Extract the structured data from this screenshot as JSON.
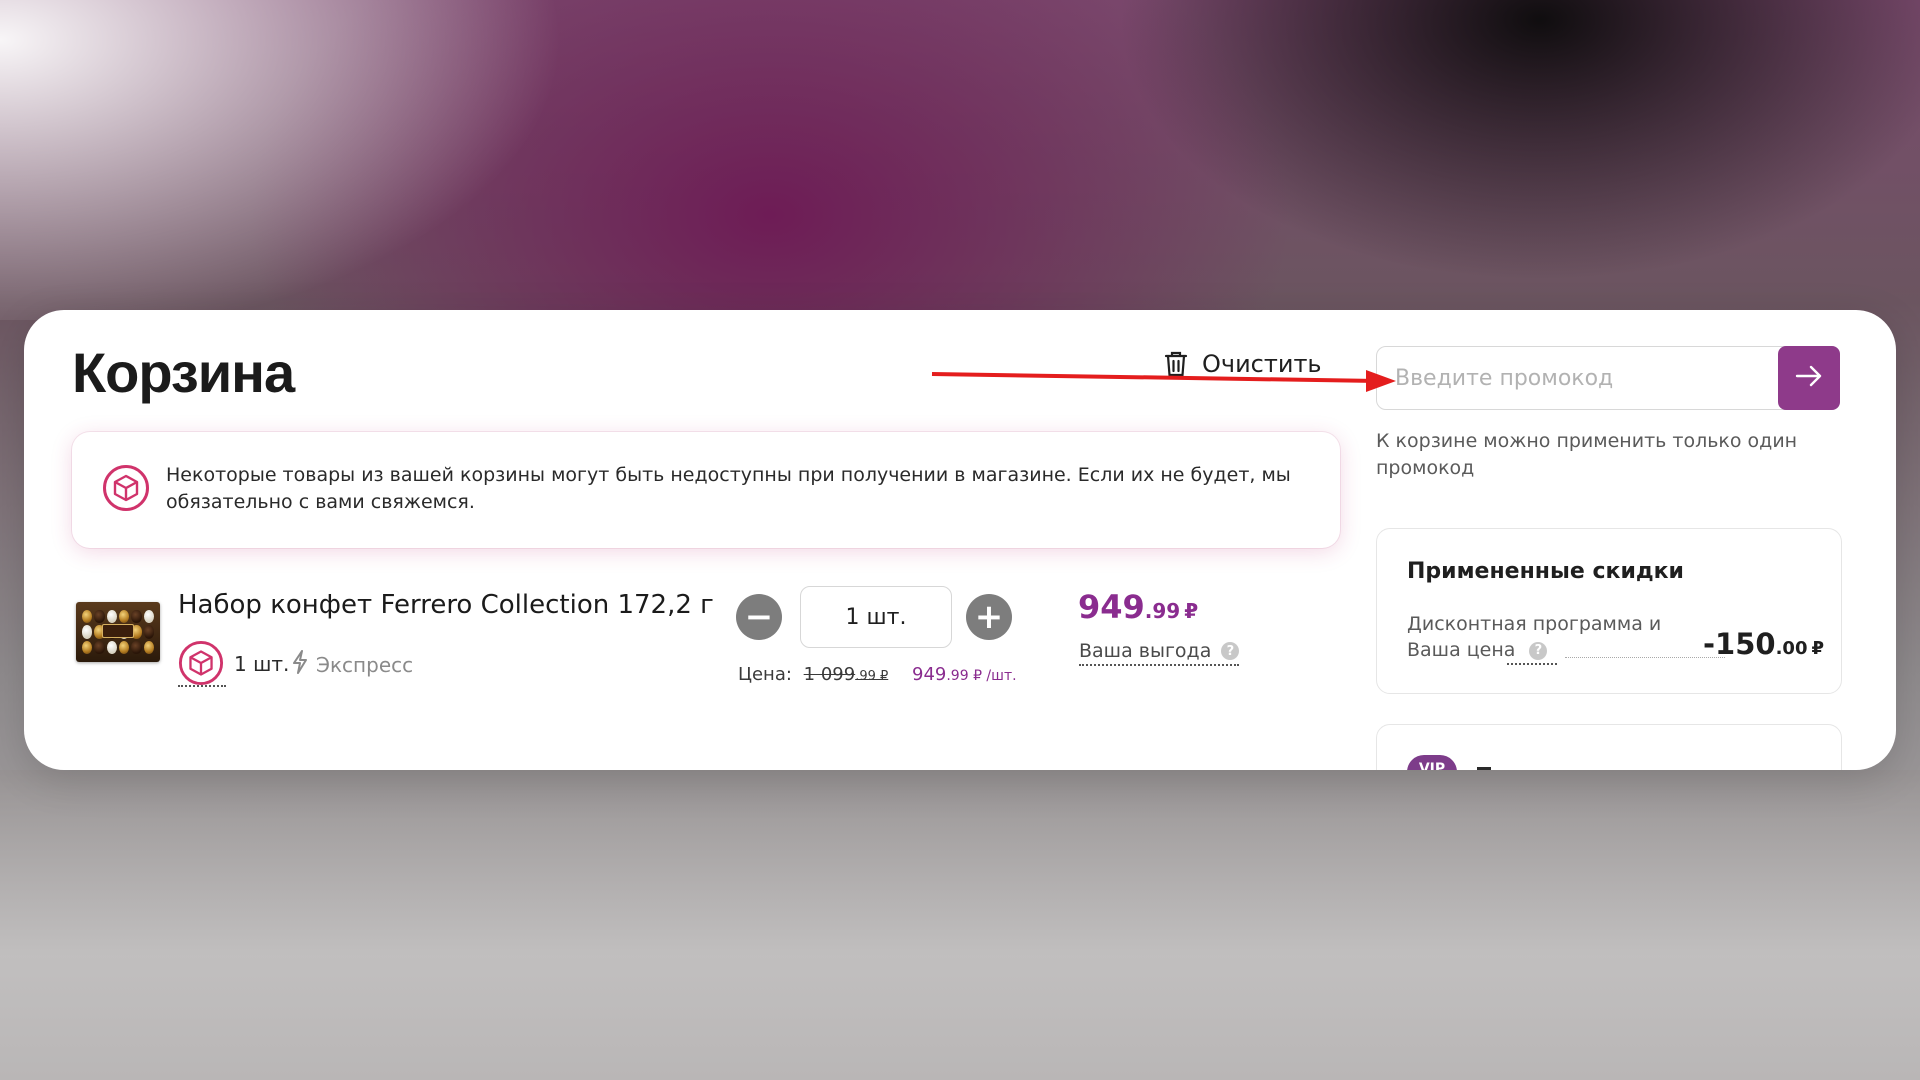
{
  "cart": {
    "title": "Корзина",
    "clear_label": "Очистить",
    "notice_text": "Некоторые товары из вашей корзины могут быть недоступны при получении в магазине. Если их не будет, мы обязательно с вами свяжемся."
  },
  "item": {
    "name": "Набор конфет Ferrero Collection 172,2 г",
    "pickup_qty": "1 шт.",
    "delivery_type": "Экспресс",
    "qty_value": "1 шт.",
    "unit_price_label": "Цена:",
    "old_price_int": "1 099",
    "old_price_dec": ".99 ₽",
    "new_price_int": "949",
    "new_price_dec": ".99 ₽ /шт.",
    "total_int": "949",
    "total_dec": ".99",
    "total_cur": "₽",
    "savings_label": "Ваша выгода"
  },
  "promo": {
    "placeholder": "Введите промокод",
    "note": "К корзине можно применить только один промокод"
  },
  "discounts": {
    "title": "Примененные скидки",
    "name": "Дисконтная программа и Ваша цена",
    "value_int": "-150",
    "value_dec": ".00",
    "value_cur": "₽"
  },
  "vip": {
    "badge": "VIP"
  },
  "colors": {
    "accent": "#8e3a8a",
    "price": "#8a2c8f",
    "pickup_icon": "#d0336b",
    "annotation_arrow": "#e41d1d"
  },
  "icons": {
    "clear": "trash-icon",
    "notice": "box-icon",
    "pickup": "box-icon",
    "express": "lightning-icon",
    "promo_submit": "arrow-right-icon"
  }
}
